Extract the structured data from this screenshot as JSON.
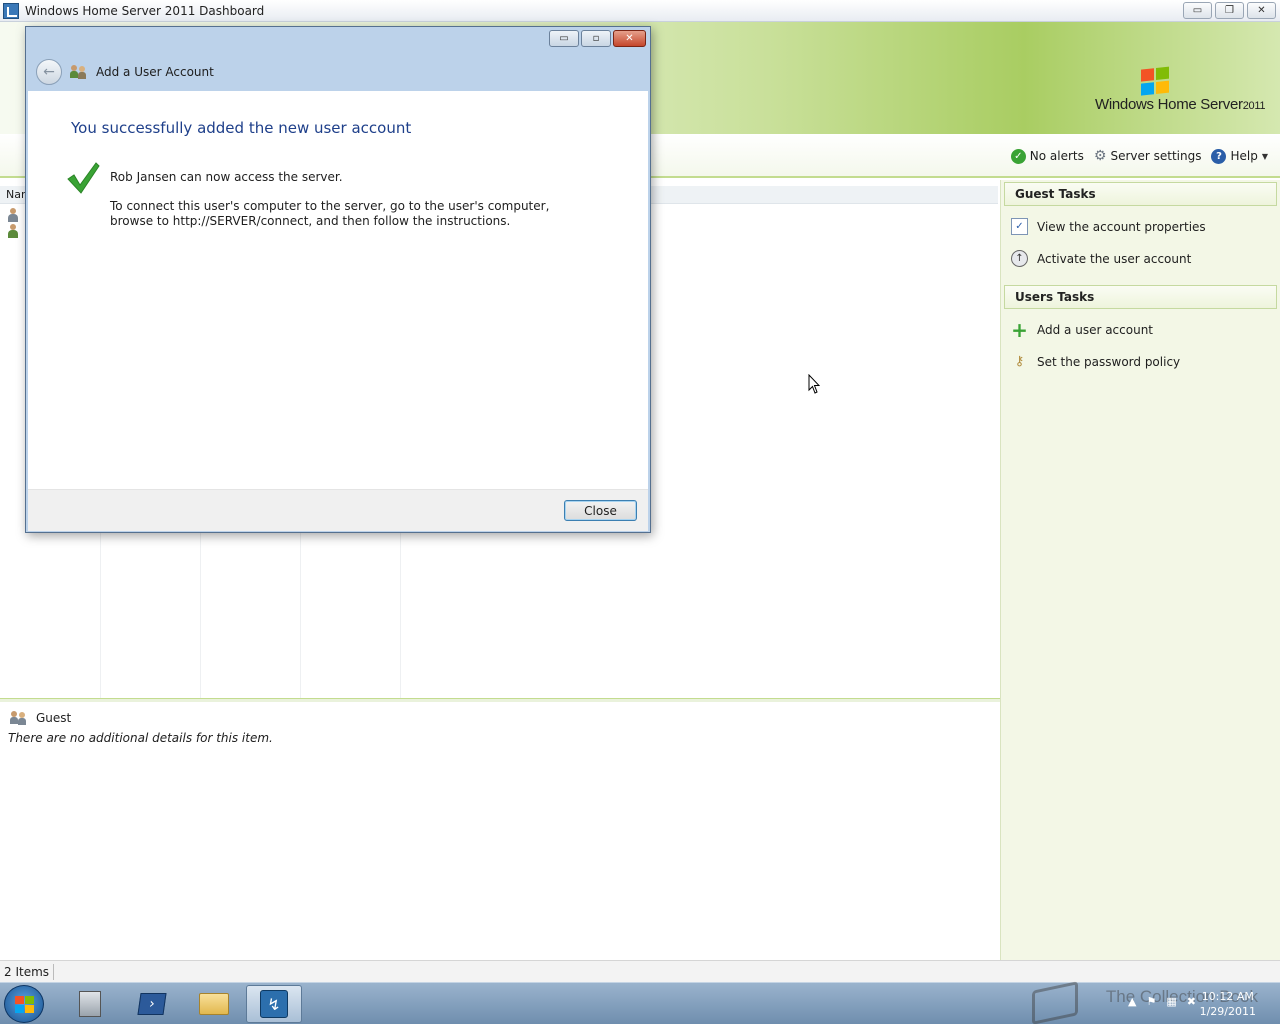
{
  "main_window": {
    "title": "Windows Home Server 2011 Dashboard",
    "controls": {
      "minimize": "▭",
      "restore": "❐",
      "close": "✕"
    }
  },
  "logo": {
    "text": "Windows Home Server",
    "year": "2011"
  },
  "toolbar": {
    "alerts_label": "No alerts",
    "settings_label": "Server settings",
    "help_label": "Help",
    "ok_icon": "✓",
    "gear_icon": "⚙",
    "help_icon": "?",
    "dropdown_icon": "▼"
  },
  "list": {
    "column_header": "Nar"
  },
  "details": {
    "title": "Guest",
    "note": "There are no additional details for this item."
  },
  "tasks": {
    "guest_header": "Guest Tasks",
    "guest_items": [
      "View the account properties",
      "Activate the user account"
    ],
    "users_header": "Users Tasks",
    "users_items": [
      "Add a user account",
      "Set the password policy"
    ],
    "icons": {
      "props": "✓",
      "activate": "↑",
      "add": "+",
      "key": "⚷"
    }
  },
  "statusbar": {
    "items_count": "2 Items"
  },
  "dialog": {
    "title": "Add a User Account",
    "heading": "You successfully added the new user account",
    "message1": "Rob Jansen can now access the server.",
    "message2": "To connect this user's computer to the server, go to the user's computer, browse to http://SERVER/connect, and then follow the instructions.",
    "close_button": "Close",
    "back_icon": "←",
    "controls": {
      "minimize": "▭",
      "restore": "▫",
      "close": "✕"
    }
  },
  "taskbar": {
    "tray_icons": [
      "▲",
      "⚑",
      "▦",
      "✖"
    ],
    "ps_icon": "›",
    "dash_icon": "↯",
    "time": "10:12 AM",
    "date": "1/29/2011",
    "watermark": "The Collection Book"
  },
  "colors": {
    "banner_green": "#a9cd62",
    "dialog_frame": "#bcd2ea",
    "heading_blue": "#1e3f8a",
    "check_green": "#3aa335"
  }
}
